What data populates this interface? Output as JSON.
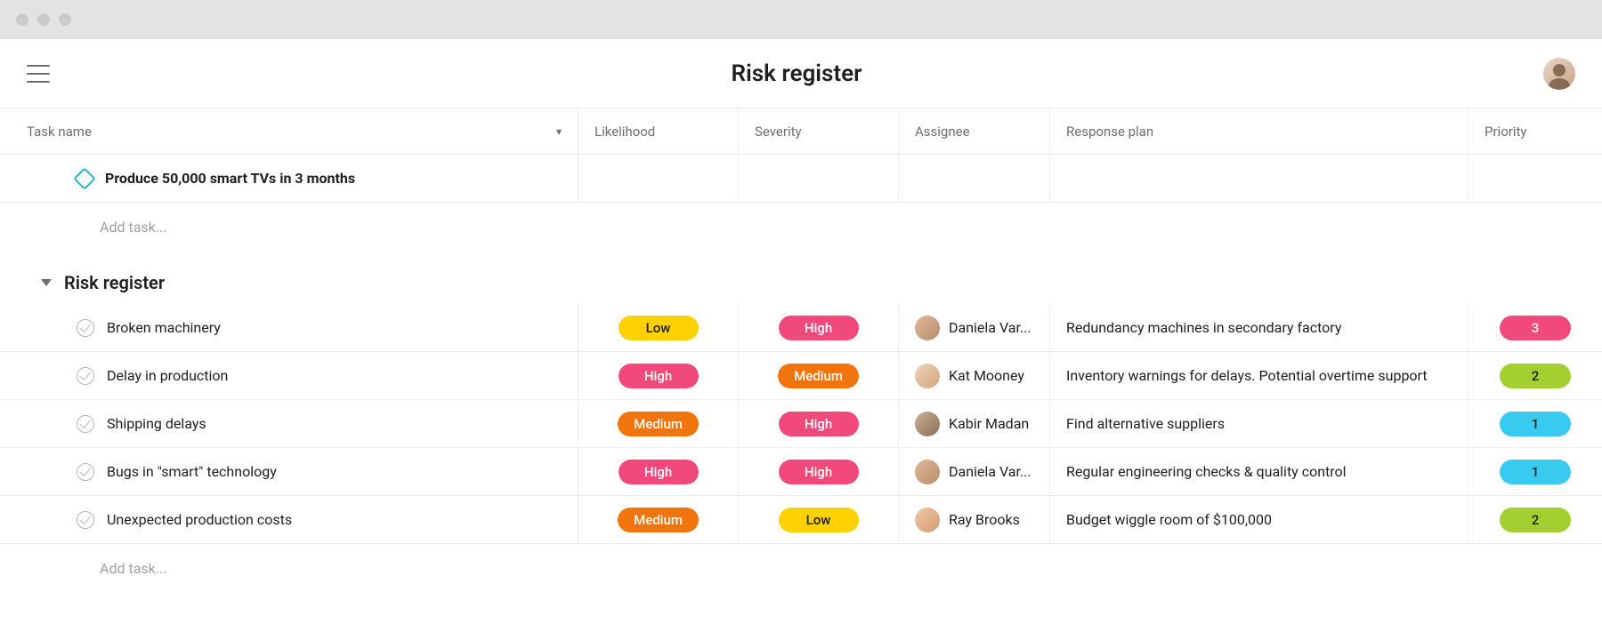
{
  "header": {
    "title": "Risk register"
  },
  "columns": {
    "task_name": "Task name",
    "likelihood": "Likelihood",
    "severity": "Severity",
    "assignee": "Assignee",
    "response_plan": "Response plan",
    "priority": "Priority"
  },
  "milestone": {
    "title": "Produce 50,000 smart TVs in 3 months"
  },
  "add_task_label": "Add task...",
  "section": {
    "title": "Risk register"
  },
  "pill_colors": {
    "Low": "pill-yellow",
    "Medium": "pill-orange",
    "High": "pill-pink",
    "1": "pill-cyan",
    "2": "pill-green",
    "3": "pill-pink"
  },
  "tasks": [
    {
      "title": "Broken machinery",
      "likelihood": "Low",
      "severity": "High",
      "assignee": "Daniela Var...",
      "avatar_class": "b1",
      "response_plan": "Redundancy machines in secondary factory",
      "priority": "3"
    },
    {
      "title": "Delay in production",
      "likelihood": "High",
      "severity": "Medium",
      "assignee": "Kat Mooney",
      "avatar_class": "b2",
      "response_plan": "Inventory warnings for delays. Potential overtime support",
      "priority": "2"
    },
    {
      "title": "Shipping delays",
      "likelihood": "Medium",
      "severity": "High",
      "assignee": "Kabir Madan",
      "avatar_class": "b3",
      "response_plan": "Find alternative suppliers",
      "priority": "1"
    },
    {
      "title": "Bugs in \"smart\" technology",
      "likelihood": "High",
      "severity": "High",
      "assignee": "Daniela Var...",
      "avatar_class": "b1",
      "response_plan": "Regular engineering checks & quality control",
      "priority": "1"
    },
    {
      "title": "Unexpected production costs",
      "likelihood": "Medium",
      "severity": "Low",
      "assignee": "Ray Brooks",
      "avatar_class": "b4",
      "response_plan": "Budget wiggle room of $100,000",
      "priority": "2"
    }
  ]
}
